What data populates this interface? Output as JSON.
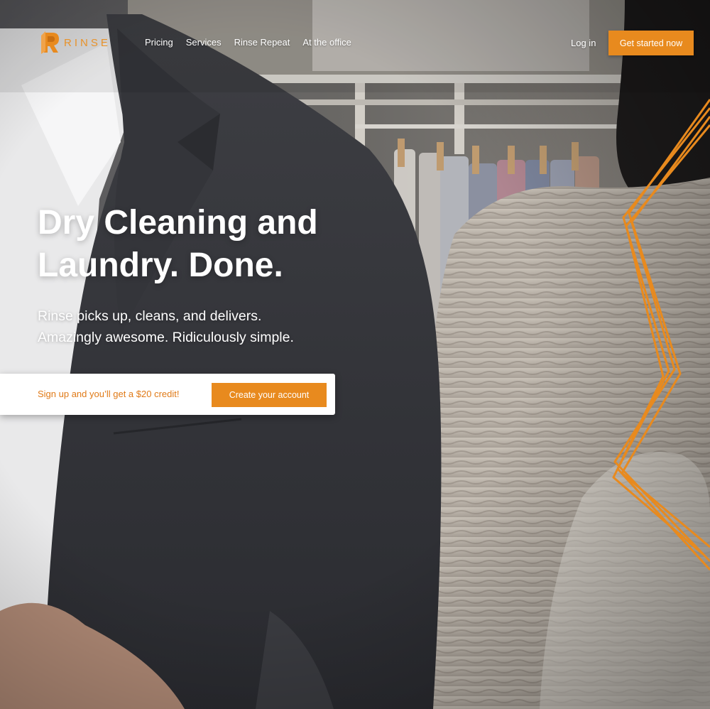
{
  "brand": {
    "name": "RINSE",
    "accent": "#e88a1e"
  },
  "nav": {
    "items": [
      {
        "label": "Pricing"
      },
      {
        "label": "Services"
      },
      {
        "label": "Rinse Repeat"
      },
      {
        "label": "At the office"
      }
    ],
    "login_label": "Log in",
    "cta_label": "Get started now"
  },
  "hero": {
    "headline": "Dry Cleaning and Laundry. Done.",
    "subhead_line1": "Rinse picks up, cleans, and delivers.",
    "subhead_line2": "Amazingly awesome. Ridiculously simple."
  },
  "signup": {
    "promo_text": "Sign up and you’ll get a $20 credit!",
    "button_label": "Create your account"
  },
  "icons": {
    "logo": "rinse-logo-icon",
    "decoration": "orange-zigzag-lines"
  }
}
